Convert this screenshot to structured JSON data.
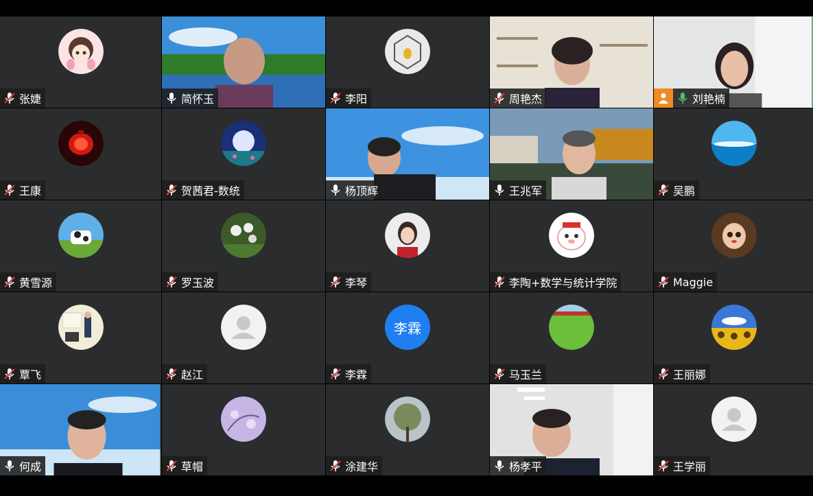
{
  "participants": [
    {
      "name": "张婕",
      "mic": "muted",
      "tile": "avatar",
      "avatar": "cartoon-girl-avatar"
    },
    {
      "name": "简怀玉",
      "mic": "on",
      "tile": "video",
      "video": "lake-scenery-video"
    },
    {
      "name": "李阳",
      "mic": "muted",
      "tile": "avatar",
      "avatar": "geometric-sculpture-avatar"
    },
    {
      "name": "周艳杰",
      "mic": "muted",
      "tile": "video",
      "video": "bookshelf-room-video"
    },
    {
      "name": "刘艳楠",
      "mic": "on",
      "tile": "video",
      "video": "white-room-video",
      "host": true,
      "active": true
    },
    {
      "name": "王康",
      "mic": "muted",
      "tile": "avatar",
      "avatar": "red-lantern-avatar"
    },
    {
      "name": "贺茜君-数统",
      "mic": "muted",
      "tile": "avatar",
      "avatar": "moon-lake-avatar"
    },
    {
      "name": "杨顶辉",
      "mic": "on",
      "tile": "video",
      "video": "sky-background-video"
    },
    {
      "name": "王兆军",
      "mic": "on",
      "tile": "video",
      "video": "campus-building-video"
    },
    {
      "name": "吴鹏",
      "mic": "muted",
      "tile": "avatar",
      "avatar": "ocean-sky-avatar"
    },
    {
      "name": "黄雪源",
      "mic": "muted",
      "tile": "avatar",
      "avatar": "cow-meadow-avatar"
    },
    {
      "name": "罗玉波",
      "mic": "muted",
      "tile": "avatar",
      "avatar": "dandelion-avatar"
    },
    {
      "name": "李琴",
      "mic": "muted",
      "tile": "avatar",
      "avatar": "woman-portrait-avatar"
    },
    {
      "name": "李陶+数学与统计学院",
      "mic": "muted",
      "tile": "avatar",
      "avatar": "cartoon-pig-avatar"
    },
    {
      "name": "Maggie",
      "mic": "muted",
      "tile": "avatar",
      "avatar": "doll-avatar"
    },
    {
      "name": "覃飞",
      "mic": "muted",
      "tile": "avatar",
      "avatar": "lecture-photo-avatar"
    },
    {
      "name": "赵江",
      "mic": "muted",
      "tile": "avatar",
      "avatar": "default-person-avatar"
    },
    {
      "name": "李霖",
      "mic": "muted",
      "tile": "avatar",
      "avatar": "text-avatar",
      "avatar_text": "李霖"
    },
    {
      "name": "马玉兰",
      "mic": "muted",
      "tile": "avatar",
      "avatar": "grass-field-avatar"
    },
    {
      "name": "王丽娜",
      "mic": "muted",
      "tile": "avatar",
      "avatar": "sunflower-avatar"
    },
    {
      "name": "何成",
      "mic": "on",
      "tile": "video",
      "video": "sky-sea-video"
    },
    {
      "name": "草帽",
      "mic": "muted",
      "tile": "avatar",
      "avatar": "purple-blossom-avatar"
    },
    {
      "name": "涂建华",
      "mic": "muted",
      "tile": "avatar",
      "avatar": "tree-avatar"
    },
    {
      "name": "杨孝平",
      "mic": "on",
      "tile": "video",
      "video": "office-ceiling-video"
    },
    {
      "name": "王学丽",
      "mic": "muted",
      "tile": "avatar",
      "avatar": "default-person-avatar"
    }
  ],
  "colors": {
    "tile_bg": "#2b2c2e",
    "active_border": "#4ec46a",
    "host_badge": "#f08a24",
    "mic_on": "#4ec46a",
    "text_avatar_bg": "#1f7ff0"
  }
}
